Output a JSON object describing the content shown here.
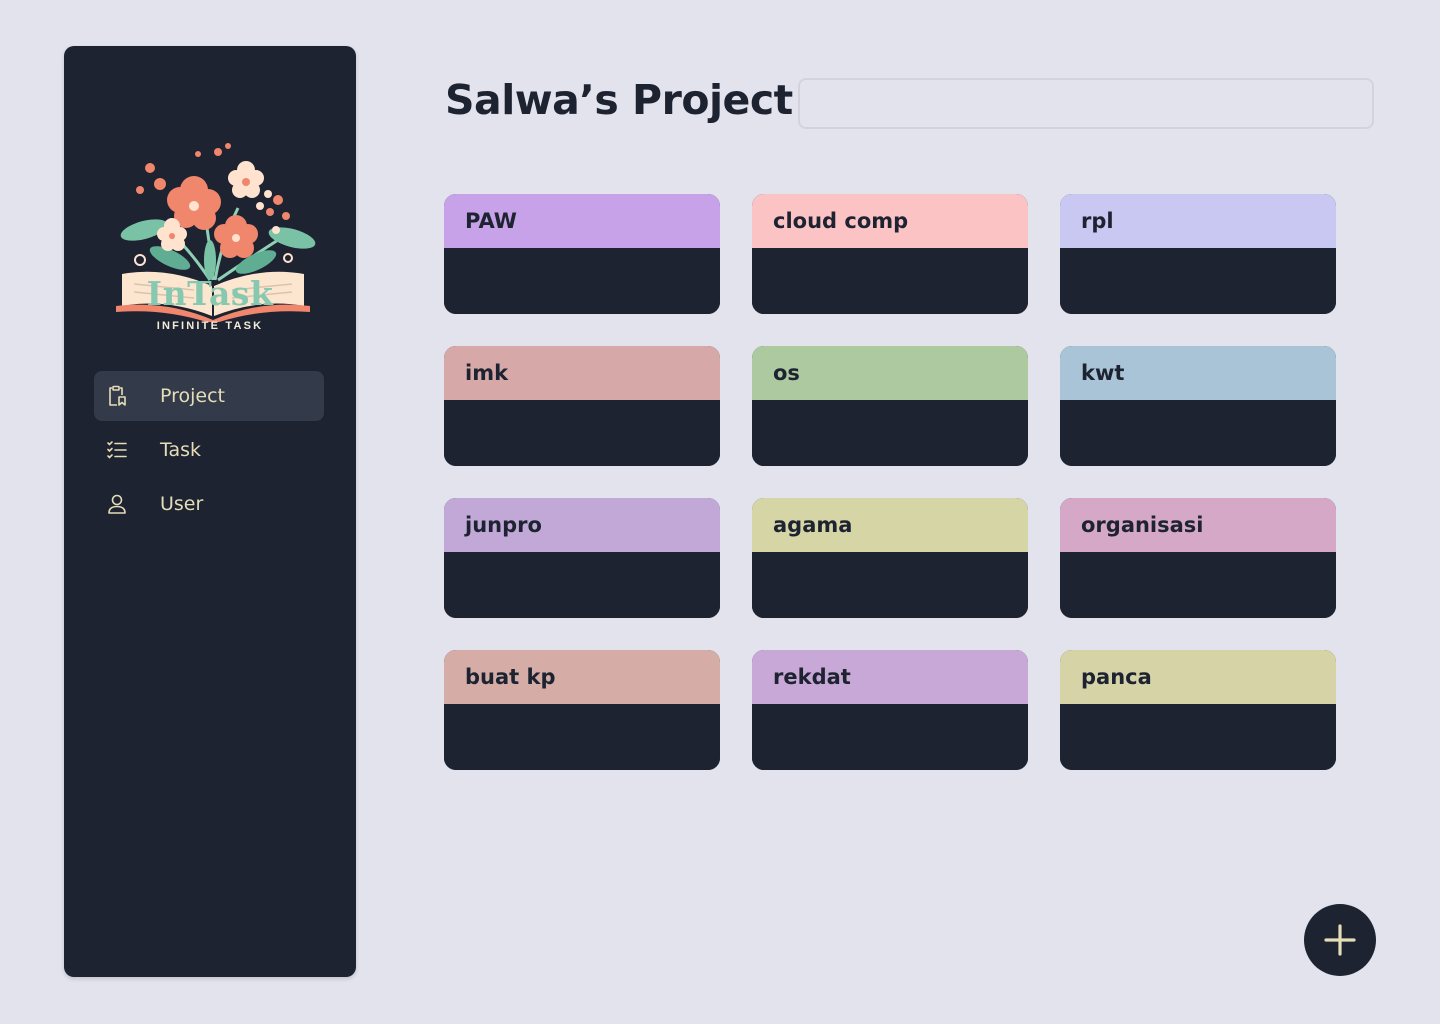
{
  "brand": {
    "name": "InTask",
    "tagline": "INFINITE TASK"
  },
  "sidebar": {
    "items": [
      {
        "label": "Project",
        "icon": "clipboard-icon",
        "active": true
      },
      {
        "label": "Task",
        "icon": "checklist-icon",
        "active": false
      },
      {
        "label": "User",
        "icon": "user-icon",
        "active": false
      }
    ]
  },
  "main": {
    "title": "Salwa’s Project",
    "search": {
      "value": "",
      "placeholder": ""
    }
  },
  "projects": [
    {
      "name": "PAW",
      "color": "#c8a2e8"
    },
    {
      "name": "cloud comp",
      "color": "#fcc3c4"
    },
    {
      "name": "rpl",
      "color": "#c8c8f2"
    },
    {
      "name": "imk",
      "color": "#d6a8a8"
    },
    {
      "name": "os",
      "color": "#adc9a0"
    },
    {
      "name": "kwt",
      "color": "#a8c4d6"
    },
    {
      "name": "junpro",
      "color": "#c2a8d7"
    },
    {
      "name": "agama",
      "color": "#d6d5a6"
    },
    {
      "name": "organisasi",
      "color": "#d6a8c8"
    },
    {
      "name": "buat kp",
      "color": "#d6aca6"
    },
    {
      "name": "rekdat",
      "color": "#c8a8d6"
    },
    {
      "name": "panca",
      "color": "#d6d4a6"
    }
  ],
  "fab": {
    "icon": "plus-icon"
  },
  "colors": {
    "background": "#e3e3ed",
    "sidebar": "#1e2331",
    "nav_active": "#333a49",
    "nav_text": "#e5ddb8",
    "brand_text": "#86c8b0",
    "fab_icon": "#e5ddb8"
  }
}
